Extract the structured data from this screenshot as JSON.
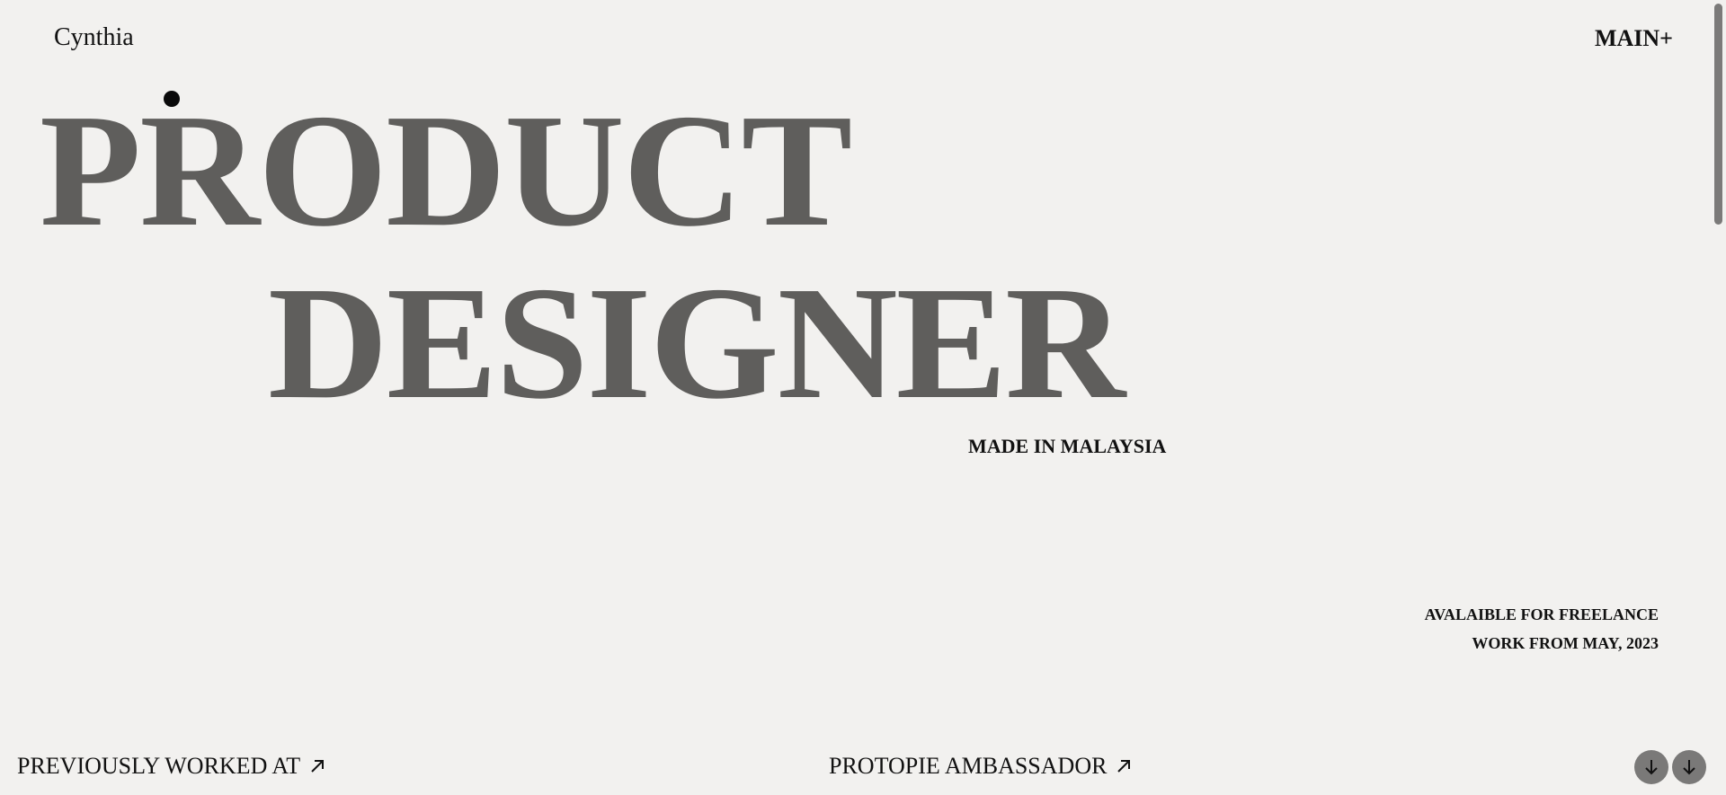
{
  "header": {
    "brand": "Cynthia",
    "menu_label": "MAIN+"
  },
  "hero": {
    "line1": "PRODUCT",
    "line2": "DESIGNER",
    "tagline": "MADE IN MALAYSIA"
  },
  "availability": {
    "line1": "AVALAIBLE FOR FREELANCE",
    "line2": "WORK FROM MAY, 2023"
  },
  "footer": {
    "link_left": "PREVIOUSLY WORKED AT",
    "link_mid": "PROTOPIE AMBASSADOR",
    "scroll_buttons": [
      "arrow-down-icon",
      "arrow-down-icon"
    ]
  },
  "colors": {
    "background": "#f2f1ef",
    "hero_text": "#5f5e5c",
    "text": "#111111",
    "button": "#7a7978"
  }
}
